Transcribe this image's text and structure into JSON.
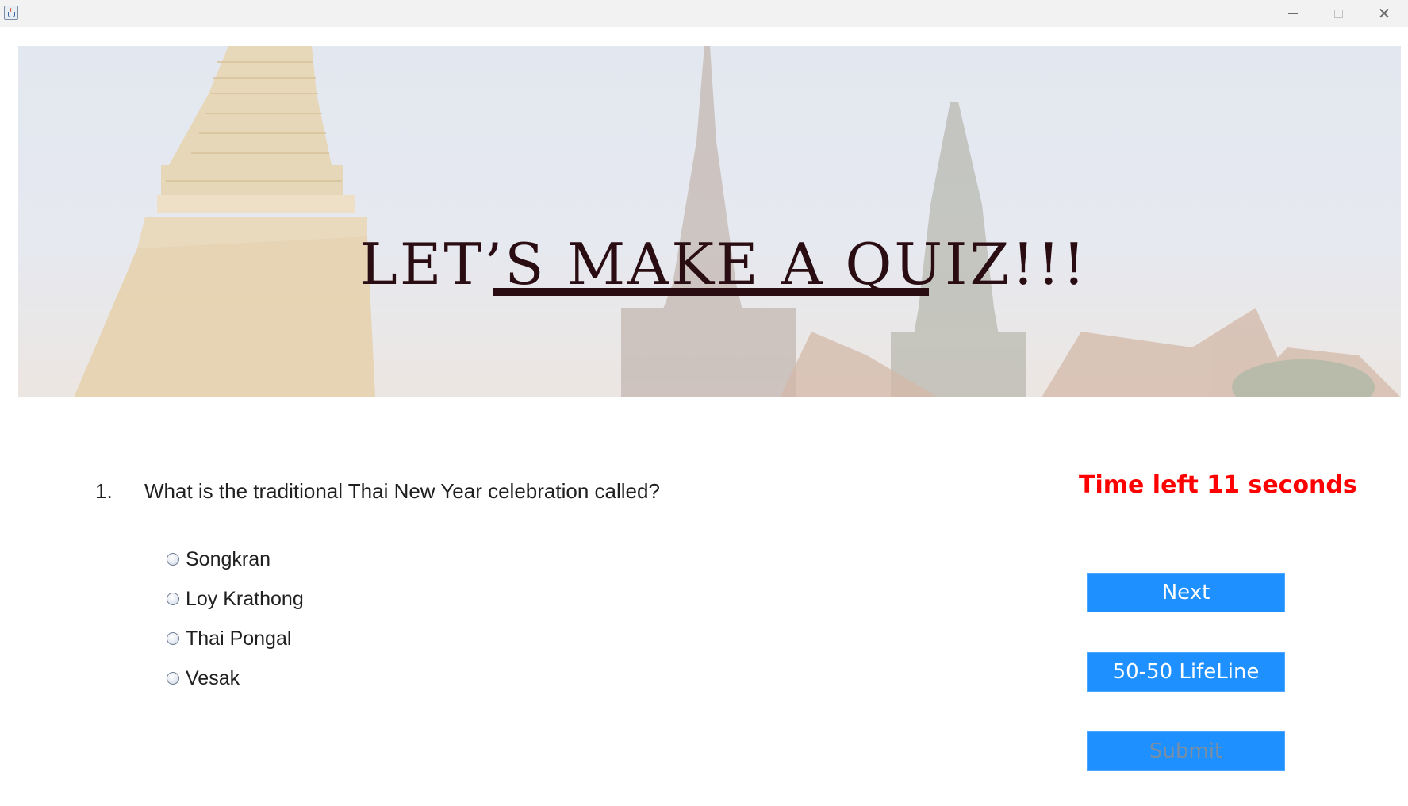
{
  "window": {
    "minimize_glyph": "",
    "close_glyph": "✕"
  },
  "banner": {
    "title": "LET’S MAKE A QUIZ!!!"
  },
  "question": {
    "number": "1.",
    "text": "What is the traditional Thai New Year celebration called?"
  },
  "options": [
    {
      "label": "Songkran",
      "selected": false
    },
    {
      "label": "Loy Krathong",
      "selected": false
    },
    {
      "label": "Thai Pongal",
      "selected": false
    },
    {
      "label": "Vesak",
      "selected": false
    }
  ],
  "timer": {
    "text": "Time left 11 seconds",
    "color": "#ff0000"
  },
  "buttons": {
    "next": "Next",
    "lifeline": "50-50 LifeLine",
    "submit": "Submit",
    "submit_enabled": false
  },
  "colors": {
    "button_bg": "#1e90ff",
    "title_color": "#2a0c13"
  }
}
